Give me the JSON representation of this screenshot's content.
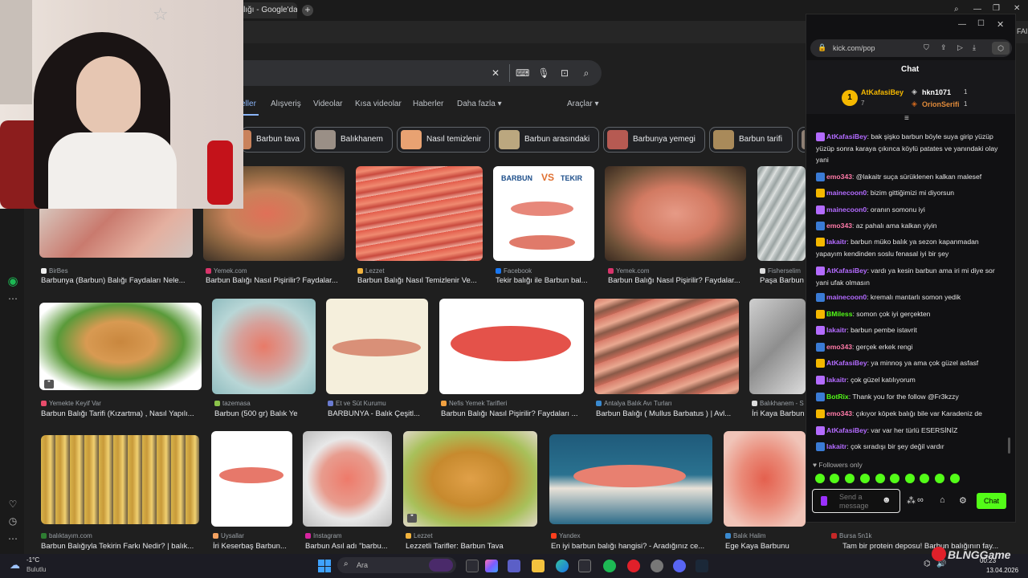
{
  "browser": {
    "tab_title": "balığı - Google'da",
    "new_tab": "+",
    "profile_badge": "FAI"
  },
  "search": {
    "tabs": [
      "eller",
      "Alışveriş",
      "Videolar",
      "Kısa videolar",
      "Haberler",
      "Daha fazla ▾"
    ],
    "tools": "Araçlar ▾",
    "chips": [
      "Barbun tava",
      "Balıkhanem",
      "Nasıl temizlenir",
      "Barbun arasındaki",
      "Barbunya yemegi",
      "Barbun tarifi"
    ]
  },
  "results": {
    "row1": [
      {
        "source": "BirBes",
        "caption": "Barbunya (Barbun) Balığı Faydaları Nele..."
      },
      {
        "source": "Yemek.com",
        "caption": "Barbun Balığı Nasıl Pişirilir? Faydalar..."
      },
      {
        "source": "Lezzet",
        "caption": "Barbun Balığı Nasıl Temizlenir Ve..."
      },
      {
        "source": "Facebook",
        "caption": "Tekir balığı ile Barbun bal..."
      },
      {
        "source": "Yemek.com",
        "caption": "Barbun Balığı Nasıl Pişirilir? Faydalar..."
      },
      {
        "source": "Fisherselim",
        "caption": "Paşa Barbun"
      }
    ],
    "row2": [
      {
        "source": "Yemekte Keyif Var",
        "caption": "Barbun Balığı Tarifi (Kızartma) , Nasıl Yapılı..."
      },
      {
        "source": "tazemasa",
        "caption": "Barbun (500 gr) Balık Ye"
      },
      {
        "source": "Et ve Süt Kurumu",
        "caption": "BARBUNYA - Balık Çeşitl..."
      },
      {
        "source": "Nefis Yemek Tarifleri",
        "caption": "Barbun Balığı Nasıl Pişirilir? Faydaları ..."
      },
      {
        "source": "Antalya Balık Avı Turları",
        "caption": "Barbun Balığı ( Mullus Barbatus ) | Avl..."
      },
      {
        "source": "Balıkhanem - S",
        "caption": "İri Kaya Barbun"
      }
    ],
    "row3": [
      {
        "source": "balıktayım.com",
        "caption": "Barbun Balığıyla Tekirin Farkı Nedir? | balık..."
      },
      {
        "source": "Uysallar",
        "caption": "İri Keserbaş Barbun..."
      },
      {
        "source": "Instagram",
        "caption": "Barbun Asıl adı \"barbu..."
      },
      {
        "source": "Lezzet",
        "caption": "Lezzetli Tarifler: Barbun Tava"
      },
      {
        "source": "Yandex",
        "caption": "En iyi barbun balığı hangisi? - Aradığınız ce..."
      },
      {
        "source": "Balık Halim",
        "caption": "Ege Kaya Barbunu"
      },
      {
        "source": "Bursa 5n1k",
        "caption": "Tam bir protein deposu! Barbun balığının fay..."
      }
    ],
    "tekir_image": {
      "left": "BARBUN",
      "vs": "VS",
      "right": "TEKIR"
    }
  },
  "chat": {
    "url": "kick.com/pop",
    "title": "Chat",
    "leaderboard": {
      "first": {
        "rank": "1",
        "name": "AtKafasiBey",
        "count": "7"
      },
      "second": {
        "name": "hkn1071",
        "count": "1"
      },
      "third": {
        "name": "OrionSerifi",
        "count": "1"
      }
    },
    "messages": [
      {
        "user": "AtKafasiBey",
        "color": "#b36bff",
        "text": ": bak şişko barbun böyle suya girip yüzüp yüzüp sonra karaya çıkınca köylü patates ve yanındaki olay yani"
      },
      {
        "user": "emo343",
        "color": "#ff7aa8",
        "text": ": @lakaitr suça sürüklenen kalkan malesef"
      },
      {
        "user": "mainecoon0",
        "color": "#b36bff",
        "text": ": bizim gittiğimizi mi diyorsun"
      },
      {
        "user": "mainecoon0",
        "color": "#b36bff",
        "text": ": oranın somonu iyi"
      },
      {
        "user": "emo343",
        "color": "#ff7aa8",
        "text": ": az pahalı ama kalkan yiyin"
      },
      {
        "user": "lakaitr",
        "color": "#b36bff",
        "text": ": barbun müko balık ya sezon kapanmadan yapayım kendinden soslu fenasal iyi bir şey"
      },
      {
        "user": "AtKafasiBey",
        "color": "#b36bff",
        "text": ": vardı ya kesin barbun ama iri mi diye sor yani ufak olmasın"
      },
      {
        "user": "mainecoon0",
        "color": "#b36bff",
        "text": ": kremalı mantarlı somon yedik"
      },
      {
        "user": "BMiless",
        "color": "#53fc18",
        "text": ": somon çok iyi gerçekten"
      },
      {
        "user": "lakaitr",
        "color": "#b36bff",
        "text": ": barbun pembe istavrit"
      },
      {
        "user": "emo343",
        "color": "#ff7aa8",
        "text": ": gerçek erkek rengi"
      },
      {
        "user": "AtKafasiBey",
        "color": "#b36bff",
        "text": ": ya minnoş ya ama çok güzel asfasf"
      },
      {
        "user": "lakaitr",
        "color": "#b36bff",
        "text": ": çok güzel katılıyorum"
      },
      {
        "user": "BotRix",
        "color": "#53fc18",
        "text": ": Thank you for the follow @Fr3kzzy"
      },
      {
        "user": "emo343",
        "color": "#ff7aa8",
        "text": ": çıkıyor köpek balığı bile var Karadeniz de"
      },
      {
        "user": "AtKafasiBey",
        "color": "#b36bff",
        "text": ": var var her türlü ESERSİNİZ"
      },
      {
        "user": "lakaitr",
        "color": "#b36bff",
        "text": ": çok sıradışı bir şey değil vardır"
      }
    ],
    "followers_only": "Followers only",
    "input_placeholder": "Send a message",
    "send_button": "Chat"
  },
  "taskbar": {
    "weather_temp": "-1°C",
    "weather_desc": "Bulutlu",
    "search_placeholder": "Ara",
    "time": "00:23",
    "date": "13.04.2026",
    "watermark": "BLNGGame"
  }
}
